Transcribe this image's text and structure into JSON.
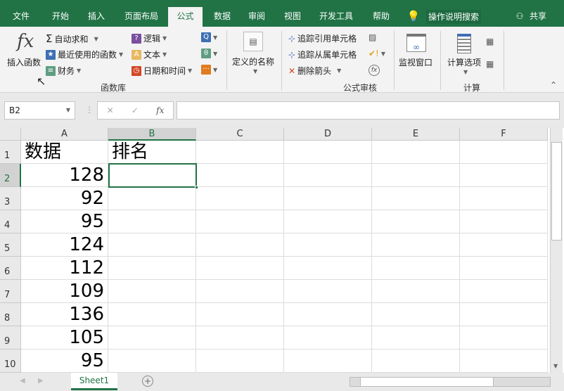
{
  "tabs": [
    "文件",
    "开始",
    "插入",
    "页面布局",
    "公式",
    "数据",
    "审阅",
    "视图",
    "开发工具",
    "帮助"
  ],
  "active_tab": "公式",
  "tell_me": "操作说明搜索",
  "share": "共享",
  "ribbon": {
    "insert_function": "插入函数",
    "autosum": "自动求和",
    "recent": "最近使用的函数",
    "financial": "财务",
    "logical": "逻辑",
    "text": "文本",
    "datetime": "日期和时间",
    "lookup_icon": "Q",
    "math_icon": "θ",
    "more_icon": "···",
    "group_library": "函数库",
    "defined_names": "定义的名称",
    "trace_precedents": "追踪引用单元格",
    "trace_dependents": "追踪从属单元格",
    "remove_arrows": "删除箭头",
    "group_audit": "公式审核",
    "watch": "监视窗口",
    "calc_options": "计算选项",
    "group_calc": "计算",
    "fx": "fx"
  },
  "formula_bar": {
    "name_box": "B2",
    "formula": "",
    "fx": "fx"
  },
  "columns": [
    "A",
    "B",
    "C",
    "D",
    "E",
    "F"
  ],
  "rows": [
    {
      "n": "1",
      "a": "数据",
      "b": "排名"
    },
    {
      "n": "2",
      "a": "128",
      "b": ""
    },
    {
      "n": "3",
      "a": "92",
      "b": ""
    },
    {
      "n": "4",
      "a": "95",
      "b": ""
    },
    {
      "n": "5",
      "a": "124",
      "b": ""
    },
    {
      "n": "6",
      "a": "112",
      "b": ""
    },
    {
      "n": "7",
      "a": "109",
      "b": ""
    },
    {
      "n": "8",
      "a": "136",
      "b": ""
    },
    {
      "n": "9",
      "a": "105",
      "b": ""
    },
    {
      "n": "10",
      "a": "95",
      "b": ""
    }
  ],
  "sheet_tab": "Sheet1",
  "colors": {
    "accent": "#217346"
  }
}
